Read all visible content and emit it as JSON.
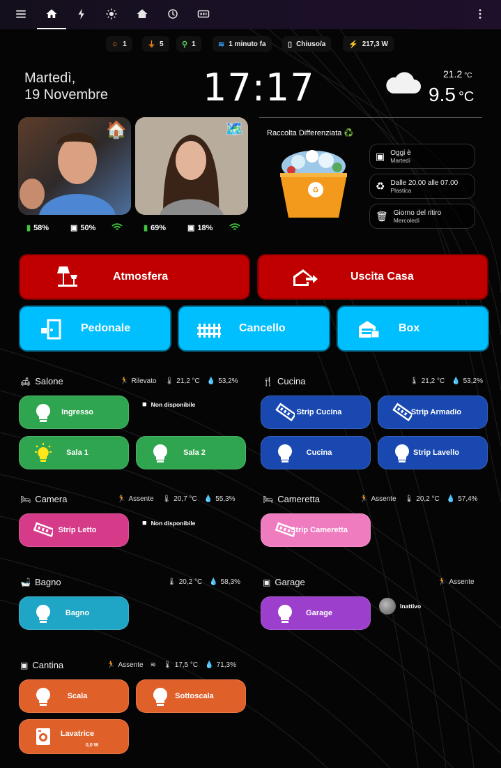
{
  "statusbar": [
    {
      "icon": "light-icon",
      "value": "1",
      "color": "#ff8c1a"
    },
    {
      "icon": "plug-icon",
      "value": "5",
      "color": "#ff8c1a"
    },
    {
      "icon": "motion-icon",
      "value": "1",
      "color": "#5fd35f"
    },
    {
      "icon": "water-icon",
      "value": "1 minuto fa",
      "color": "#39a0ff"
    },
    {
      "icon": "door-icon",
      "value": "Chiuso/a",
      "color": "#dddddd"
    },
    {
      "icon": "power-icon",
      "value": "217,3 W",
      "color": "#ff3030"
    }
  ],
  "header": {
    "day": "Martedì,",
    "date": "19 Novembre",
    "time": "17:17",
    "temp_min": "21.2",
    "temp_min_unit": "°C",
    "temp_max": "9.5",
    "temp_max_unit": "°C",
    "weather_icon": "cloud-icon"
  },
  "people": [
    {
      "battery": "58%",
      "storage": "50%",
      "wifi": "wifi-icon",
      "badge": "home-icon"
    },
    {
      "battery": "69%",
      "storage": "18%",
      "wifi": "wifi-icon",
      "badge": "map-pin-icon"
    }
  ],
  "raccolta": {
    "title": "Raccolta Differenziata ♻️",
    "items": [
      {
        "line1": "Oggi è",
        "line2": "Martedì",
        "icon": "calendar-icon"
      },
      {
        "line1": "Dalle 20.00 alle 07.00",
        "line2": "Plastica",
        "icon": "recycle-icon"
      },
      {
        "line1": "Giorno del ritiro",
        "line2": "Mercoledì",
        "icon": "trash-icon"
      }
    ]
  },
  "actions": {
    "atmosfera": "Atmosfera",
    "uscita": "Uscita Casa",
    "pedonale": "Pedonale",
    "cancello": "Cancello",
    "box": "Box"
  },
  "rooms": {
    "salone": {
      "name": "Salone",
      "motion": "Rilevato",
      "temp": "21,2 °C",
      "hum": "53,2%"
    },
    "cucina": {
      "name": "Cucina",
      "temp": "21,2 °C",
      "hum": "53,2%"
    },
    "camera": {
      "name": "Camera",
      "motion": "Assente",
      "temp": "20,7 °C",
      "hum": "55,3%"
    },
    "cameretta": {
      "name": "Cameretta",
      "motion": "Assente",
      "temp": "20,2 °C",
      "hum": "57,4%"
    },
    "bagno": {
      "name": "Bagno",
      "temp": "20,2 °C",
      "hum": "58,3%"
    },
    "garage": {
      "name": "Garage",
      "motion": "Assente"
    },
    "cantina": {
      "name": "Cantina",
      "motion": "Assente",
      "temp": "17,5 °C",
      "hum": "71,3%"
    }
  },
  "tiles": {
    "ingresso": "Ingresso",
    "strip_cucina": "Strip Cucina",
    "strip_armadio": "Strip Armadio",
    "sala1": "Sala 1",
    "sala2": "Sala 2",
    "cucina": "Cucina",
    "strip_lavello": "Strip Lavello",
    "strip_letto": "Strip Letto",
    "strip_cameretta": "Strip Cameretta",
    "bagno": "Bagno",
    "garage": "Garage",
    "scala": "Scala",
    "sottoscala": "Sottoscala",
    "lavatrice": "Lavatrice",
    "lavatrice_power": "0,0 W",
    "cam_salone": "Non disponibile",
    "cam_camera": "Non disponibile",
    "garage_status": "Inattivo"
  },
  "colors": {
    "red": "#c00000",
    "cyan": "#00bfff",
    "green": "#30a550",
    "blue": "#1848b0",
    "pink": "#d63b8a",
    "orange": "#e0602a",
    "purple": "#9c3fcc",
    "teal": "#1fa5c5"
  }
}
